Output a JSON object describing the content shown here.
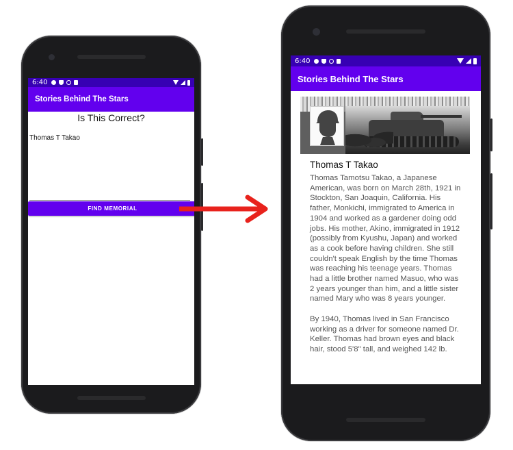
{
  "left_phone": {
    "status_bar": {
      "time": "6:40"
    },
    "app_bar": {
      "title": "Stories Behind The Stars"
    },
    "heading": "Is This Correct?",
    "selected_name": "Thomas T Takao",
    "find_button_label": "FIND MEMORIAL"
  },
  "right_phone": {
    "status_bar": {
      "time": "6:40"
    },
    "app_bar": {
      "title": "Stories Behind The Stars"
    },
    "memorial": {
      "name": "Thomas T Takao",
      "bio": "Thomas Tamotsu Takao, a Japanese American, was born on March 28th, 1921 in Stockton, San Joaquin, California. His father, Monkichi, immigrated to America in 1904 and worked as a gardener doing odd jobs. His mother, Akino, immigrated in 1912 (possibly from Kyushu, Japan) and worked as a cook before having children. She still couldn't speak English by the time Thomas was reaching his teenage years. Thomas had a little brother named Masuo, who was 2 years younger than him, and a little sister named Mary who was 8 years younger.\n\nBy 1940, Thomas lived in San Francisco working as a driver for someone named Dr. Keller. Thomas had brown eyes and black hair, stood 5'8\" tall, and weighed 142 lb."
    }
  },
  "colors": {
    "status_bar": "#3700b3",
    "app_bar": "#6200ee",
    "button": "#6200ee",
    "arrow": "#e8221c",
    "phone_body": "#1b1b1d"
  },
  "icons": [
    "settings-icon",
    "shield-icon",
    "at-sign-icon",
    "sd-card-icon",
    "wifi-icon",
    "signal-icon",
    "battery-icon",
    "back-icon",
    "home-icon",
    "recents-icon",
    "soldier-silhouette-icon",
    "arrow-right-icon"
  ]
}
